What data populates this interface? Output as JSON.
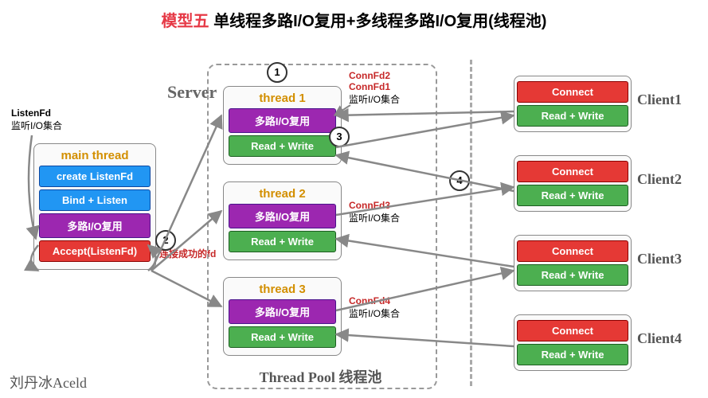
{
  "title": {
    "prefix": "模型五",
    "rest": " 单线程多路I/O复用+多线程多路I/O复用(线程池)"
  },
  "serverLabel": "Server",
  "listenFd": {
    "title": "ListenFd",
    "sub": "监听I/O集合"
  },
  "mainThread": {
    "title": "main thread",
    "create": "create ListenFd",
    "bind": "Bind + Listen",
    "mux": "多路I/O复用",
    "accept": "Accept(ListenFd)"
  },
  "connNote": "连接成功的fd",
  "pool": {
    "title": "Thread Pool 线程池",
    "threads": [
      {
        "title": "thread 1",
        "mux": "多路I/O复用",
        "rw": "Read + Write",
        "fds": "ConnFd2\nConnFd1",
        "listen": "监听I/O集合"
      },
      {
        "title": "thread 2",
        "mux": "多路I/O复用",
        "rw": "Read + Write",
        "fds": "ConnFd3",
        "listen": "监听I/O集合"
      },
      {
        "title": "thread 3",
        "mux": "多路I/O复用",
        "rw": "Read + Write",
        "fds": "ConnFd4",
        "listen": "监听I/O集合"
      }
    ]
  },
  "steps": {
    "s1": "1",
    "s2": "2",
    "s3": "3",
    "s4": "4"
  },
  "clients": [
    {
      "name": "Client1",
      "connect": "Connect",
      "rw": "Read + Write"
    },
    {
      "name": "Client2",
      "connect": "Connect",
      "rw": "Read + Write"
    },
    {
      "name": "Client3",
      "connect": "Connect",
      "rw": "Read + Write"
    },
    {
      "name": "Client4",
      "connect": "Connect",
      "rw": "Read + Write"
    }
  ],
  "signature": "刘丹冰Aceld"
}
